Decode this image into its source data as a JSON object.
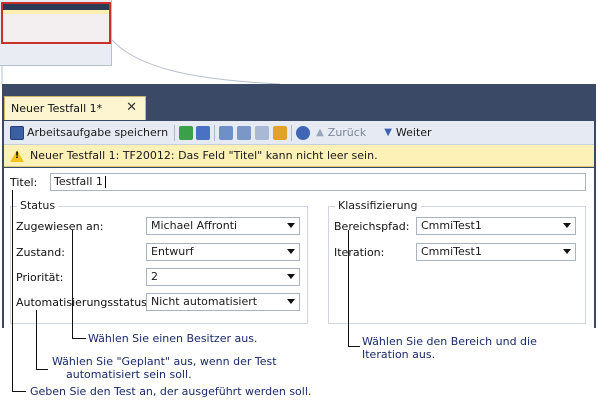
{
  "tab": {
    "title": "Neuer Testfall 1*",
    "close_glyph": "✕"
  },
  "toolbar": {
    "save_label": "Arbeitsaufgabe speichern",
    "back_label": "Zurück",
    "forward_label": "Weiter",
    "icons": [
      "save-icon",
      "refresh-icon",
      "undo-icon",
      "link-icon",
      "copy-icon",
      "attach-icon",
      "tasks-icon",
      "help-icon"
    ]
  },
  "warning": {
    "text": "Neuer Testfall 1: TF20012: Das Feld \"Titel\" kann nicht leer sein."
  },
  "form": {
    "title_label": "Titel:",
    "title_value": "Testfall 1",
    "status": {
      "legend": "Status",
      "assigned_label": "Zugewiesen an:",
      "assigned_value": "Michael Affronti",
      "state_label": "Zustand:",
      "state_value": "Entwurf",
      "priority_label": "Priorität:",
      "priority_value": "2",
      "automation_label": "Automatisierungsstatus:",
      "automation_value": "Nicht automatisiert"
    },
    "classification": {
      "legend": "Klassifizierung",
      "area_label": "Bereichspfad:",
      "area_value": "CmmiTest1",
      "iteration_label": "Iteration:",
      "iteration_value": "CmmiTest1"
    }
  },
  "annotations": {
    "owner": "Wählen Sie einen Besitzer aus.",
    "planned": "Wählen Sie \"Geplant\" aus, wenn der Test automatisiert sein soll.",
    "planned_line1": "Wählen Sie \"Geplant\" aus, wenn der Test",
    "planned_line2": "automatisiert sein soll.",
    "area": "Wählen Sie den Bereich und die Iteration aus.",
    "area_line1": "Wählen Sie den Bereich und die",
    "area_line2": "Iteration aus.",
    "title": "Geben Sie den Test an, der ausgeführt werden soll."
  },
  "colors": {
    "accent": "#3a4a66",
    "warning_bg": "#fdf1b8",
    "highlight": "#c8312a",
    "annotation_text": "#1a2a6a"
  }
}
